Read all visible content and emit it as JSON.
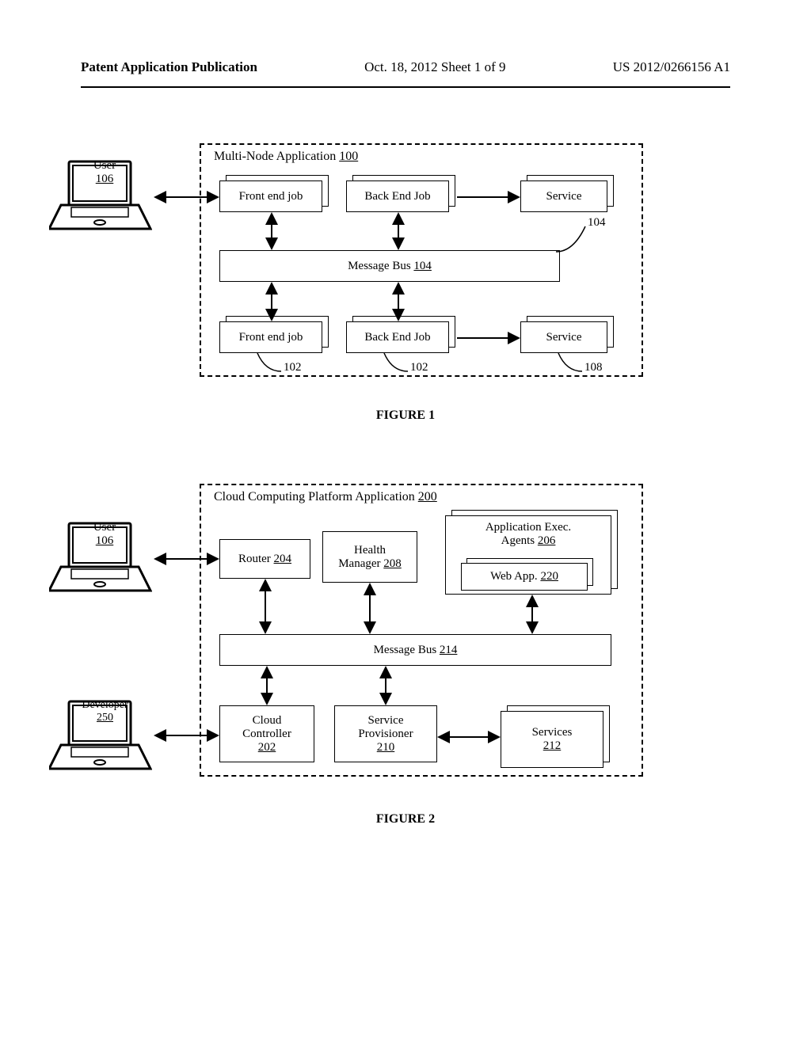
{
  "header": {
    "left": "Patent Application Publication",
    "mid": "Oct. 18, 2012  Sheet 1 of 9",
    "right": "US 2012/0266156 A1"
  },
  "fig1": {
    "caption": "FIGURE 1",
    "user_label": "User",
    "user_ref": "106",
    "app_label_a": "Multi-Node Application ",
    "app_ref": "100",
    "front_top": "Front end job",
    "back_top": "Back End Job",
    "service": "Service",
    "msgbus_label_a": "Message Bus ",
    "msgbus_ref": "104",
    "front_bot": "Front end job",
    "back_bot": "Back End Job",
    "service_bot": "Service",
    "ref_102a": "102",
    "ref_102b": "102",
    "ref_108": "108",
    "ref_104": "104"
  },
  "fig2": {
    "caption": "FIGURE 2",
    "user_label": "User",
    "user_ref": "106",
    "dev_label": "Developer",
    "dev_ref": "250",
    "app_label_a": "Cloud Computing Platform Application ",
    "app_ref": "200",
    "router_a": "Router ",
    "router_ref": "204",
    "health_a": "Health",
    "health_b": "Manager ",
    "health_ref": "208",
    "exec_a": "Application Exec.",
    "exec_b": "Agents ",
    "exec_ref": "206",
    "webapp_a": "Web App. ",
    "webapp_ref": "220",
    "msgbus_a": "Message Bus ",
    "msgbus_ref": "214",
    "cloud_a": "Cloud",
    "cloud_b": "Controller",
    "cloud_ref": "202",
    "svcprov_a": "Service",
    "svcprov_b": "Provisioner",
    "svcprov_ref": "210",
    "services_a": "Services",
    "services_ref": "212"
  },
  "icons": {
    "laptop": "laptop-icon"
  }
}
